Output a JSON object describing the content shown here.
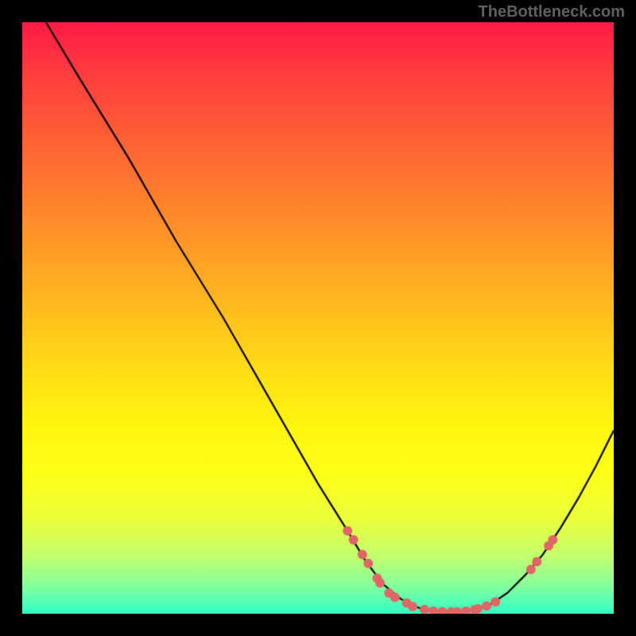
{
  "watermark": "TheBottleneck.com",
  "chart_data": {
    "type": "line",
    "title": "",
    "xlabel": "",
    "ylabel": "",
    "xlim": [
      0,
      100
    ],
    "ylim": [
      0,
      100
    ],
    "grid": false,
    "legend": false,
    "series": [
      {
        "name": "curve",
        "color": "#000000",
        "x": [
          4,
          10,
          18,
          26,
          34,
          42,
          50,
          55,
          58,
          61,
          64,
          67,
          70,
          73,
          76,
          79,
          82,
          85,
          88,
          91,
          94,
          97,
          100
        ],
        "values": [
          100,
          90,
          77,
          63,
          50,
          36,
          22,
          14,
          9,
          5,
          2.5,
          1,
          0.4,
          0.3,
          0.6,
          1.5,
          3.5,
          6.5,
          10,
          14.5,
          19.5,
          25,
          31
        ]
      }
    ],
    "markers": {
      "color": "#e06666",
      "radius": 6,
      "points": [
        {
          "x": 55,
          "y": 14
        },
        {
          "x": 56,
          "y": 12.5
        },
        {
          "x": 57.5,
          "y": 10
        },
        {
          "x": 58.5,
          "y": 8.5
        },
        {
          "x": 60,
          "y": 6
        },
        {
          "x": 60.5,
          "y": 5.2
        },
        {
          "x": 62,
          "y": 3.5
        },
        {
          "x": 63,
          "y": 2.8
        },
        {
          "x": 65,
          "y": 1.8
        },
        {
          "x": 66,
          "y": 1.2
        },
        {
          "x": 68,
          "y": 0.7
        },
        {
          "x": 69.5,
          "y": 0.45
        },
        {
          "x": 71,
          "y": 0.35
        },
        {
          "x": 72.5,
          "y": 0.32
        },
        {
          "x": 73.5,
          "y": 0.33
        },
        {
          "x": 75,
          "y": 0.45
        },
        {
          "x": 76.5,
          "y": 0.7
        },
        {
          "x": 77,
          "y": 0.85
        },
        {
          "x": 78.5,
          "y": 1.3
        },
        {
          "x": 80,
          "y": 2
        },
        {
          "x": 86,
          "y": 7.5
        },
        {
          "x": 87,
          "y": 8.8
        },
        {
          "x": 89,
          "y": 11.5
        },
        {
          "x": 89.7,
          "y": 12.5
        }
      ]
    }
  }
}
